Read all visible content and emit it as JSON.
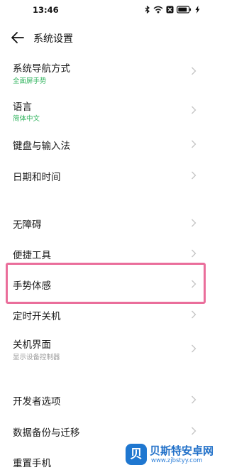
{
  "status_bar": {
    "time": "13:46"
  },
  "header": {
    "title": "系统设置"
  },
  "settings": [
    {
      "label": "系统导航方式",
      "sub": "全面屏手势"
    },
    {
      "label": "语言",
      "sub": "简体中文"
    },
    {
      "label": "键盘与输入法"
    },
    {
      "label": "日期和时间"
    },
    {
      "label": "无障碍"
    },
    {
      "label": "便捷工具"
    },
    {
      "label": "手势体感"
    },
    {
      "label": "定时开关机"
    },
    {
      "label": "关机界面",
      "sub": "显示设备控制器"
    },
    {
      "label": "开发者选项"
    },
    {
      "label": "数据备份与迁移"
    },
    {
      "label": "重置手机"
    }
  ],
  "watermark": {
    "logo": "贝",
    "title": "贝斯特安卓网",
    "url": "www.zjbstyy.com"
  },
  "colors": {
    "accent_sub": "#2fb35c",
    "highlight": "#ea6e9b",
    "chevron": "#c4c4c4"
  }
}
